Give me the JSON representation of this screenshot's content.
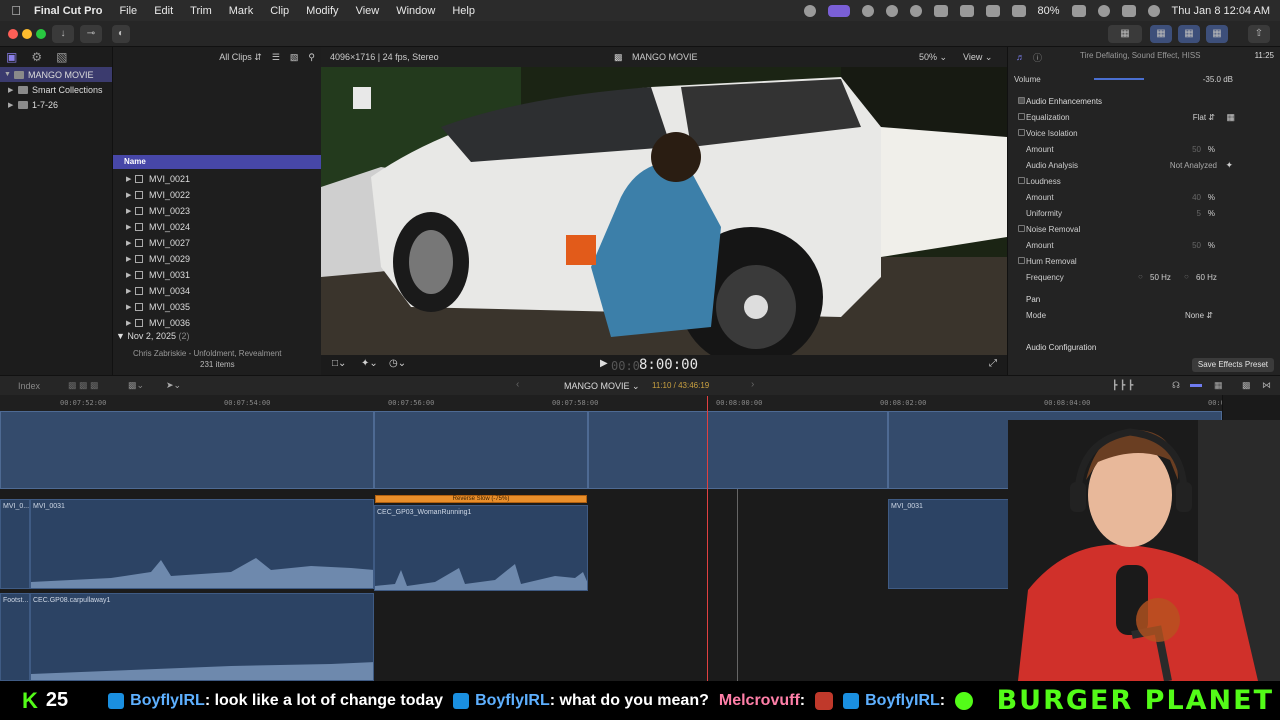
{
  "menubar": {
    "app_name": "Final Cut Pro",
    "items": [
      "File",
      "Edit",
      "Trim",
      "Mark",
      "Clip",
      "Modify",
      "View",
      "Window",
      "Help"
    ],
    "battery": "80%",
    "datetime": "Thu Jan 8  12:04 AM"
  },
  "library": {
    "items": [
      {
        "label": "MANGO MOVIE",
        "selected": true
      },
      {
        "label": "Smart Collections",
        "selected": false
      },
      {
        "label": "1-7-26",
        "selected": false
      }
    ]
  },
  "browser": {
    "filter": "All Clips",
    "name_column": "Name",
    "clips": [
      "MVI_0021",
      "MVI_0022",
      "MVI_0023",
      "MVI_0024",
      "MVI_0027",
      "MVI_0029",
      "MVI_0031",
      "MVI_0034",
      "MVI_0035",
      "MVI_0036"
    ],
    "date_group": "Nov 2, 2025",
    "date_group_count": "(2)",
    "partial_row": "Chris Zabriskie - Unfoldment, Revealment",
    "item_count": "231 items"
  },
  "viewer": {
    "format": "4096×1716 | 24 fps, Stereo",
    "project_name": "MANGO MOVIE",
    "zoom": "50%",
    "view_label": "View",
    "timecode": "8:00:00",
    "timecode_prefix": "00:0"
  },
  "inspector": {
    "clip_title": "Tire Deflating, Sound Effect, HISS",
    "clip_duration": "11:25",
    "volume_label": "Volume",
    "volume_value": "-35.0  dB",
    "audio_enhancements": "Audio Enhancements",
    "equalization": "Equalization",
    "equalization_value": "Flat",
    "voice_isolation": "Voice Isolation",
    "amount": "Amount",
    "voice_amount": "50",
    "percent": "%",
    "audio_analysis": "Audio Analysis",
    "audio_analysis_value": "Not Analyzed",
    "loudness": "Loudness",
    "loudness_amount": "40",
    "uniformity": "Uniformity",
    "uniformity_value": "5",
    "noise_removal": "Noise Removal",
    "noise_amount": "50",
    "hum_removal": "Hum Removal",
    "frequency": "Frequency",
    "freq_50": "50 Hz",
    "freq_60": "60 Hz",
    "pan": "Pan",
    "mode": "Mode",
    "mode_value": "None",
    "audio_configuration": "Audio Configuration",
    "save_preset": "Save Effects Preset"
  },
  "timeline": {
    "index_label": "Index",
    "project_name": "MANGO MOVIE",
    "duration": "11:10 / 43:46:19",
    "ruler_ticks": [
      "00:07:52:00",
      "00:07:54:00",
      "00:07:56:00",
      "00:07:58:00",
      "00:08:00:00",
      "00:08:02:00",
      "00:08:04:00",
      "00:0"
    ],
    "clip_a1": "MVI_0...",
    "clip_a2": "MVI_0031",
    "clip_retime": "Reverse Slow (-75%)",
    "clip_b": "CEC_GP03_WomanRunning1",
    "clip_c": "MVI_0031",
    "clip_d1": "Footst...",
    "clip_d2": "CEC.GP08.carpullaway1"
  },
  "stream": {
    "kick_logo": "K",
    "viewer_count": "25",
    "chat": [
      {
        "user": "BoyflyIRL",
        "message": ": look like a lot of change today"
      },
      {
        "user": "BoyflyIRL",
        "message": ": what do you mean?"
      },
      {
        "user": "Melcrovuff",
        "message": ":"
      },
      {
        "user": "BoyflyIRL",
        "message": ":"
      }
    ],
    "banner": "BURGER  PLANET"
  }
}
